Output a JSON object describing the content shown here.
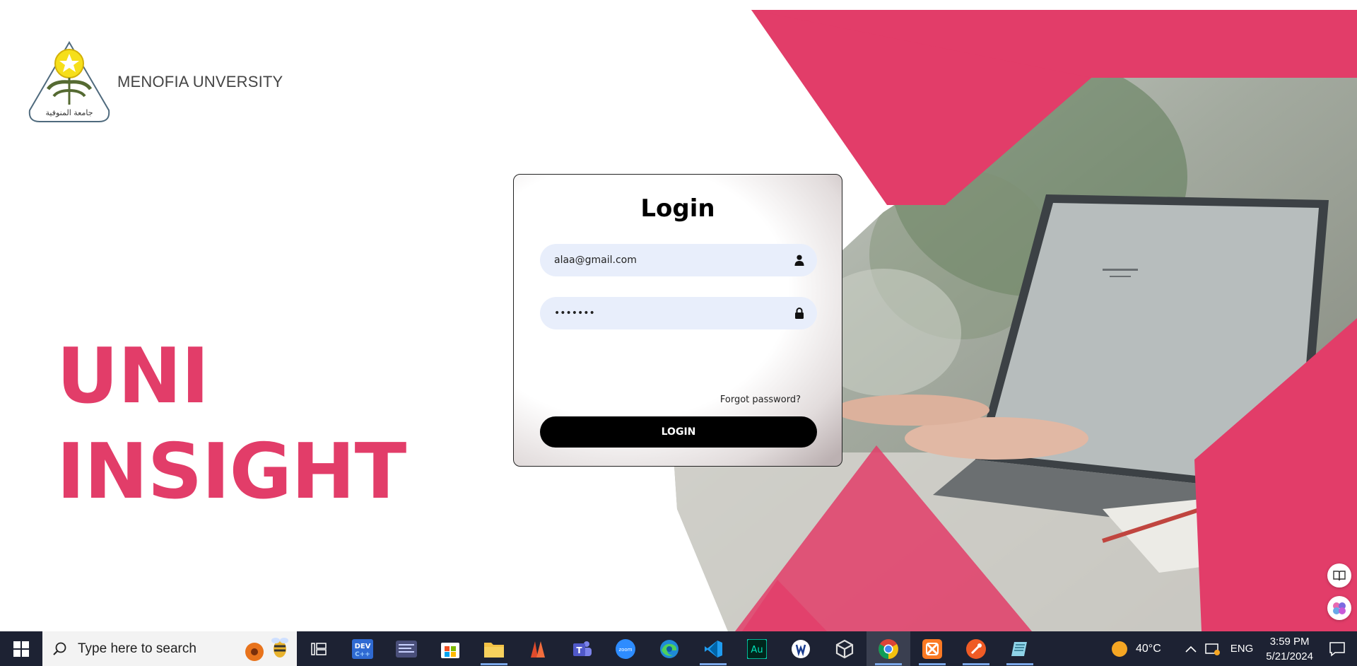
{
  "header": {
    "university_name": "MENOFIA UNVERSITY",
    "logo_caption": "جامعة المنوفية"
  },
  "brand": {
    "line1": "UNI",
    "line2": "INSIGHT"
  },
  "login": {
    "title": "Login",
    "email_value": "alaa@gmail.com",
    "password_value": "1234567",
    "forgot_label": "Forgot password?",
    "submit_label": "LOGIN"
  },
  "colors": {
    "accent": "#e23d69",
    "field_bg": "#e8eefb",
    "button_bg": "#000000",
    "taskbar_bg": "#1d2233"
  },
  "taskbar": {
    "search_placeholder": "Type here to search",
    "apps": [
      "task-view",
      "devc",
      "app-manager",
      "microsoft-store",
      "file-explorer",
      "office",
      "teams",
      "zoom",
      "edge",
      "vscode",
      "audition",
      "app",
      "unity",
      "chrome",
      "xampp",
      "postman",
      "notepad"
    ],
    "temperature": "40°C",
    "language": "ENG",
    "time": "3:59 PM",
    "date": "5/21/2024"
  }
}
